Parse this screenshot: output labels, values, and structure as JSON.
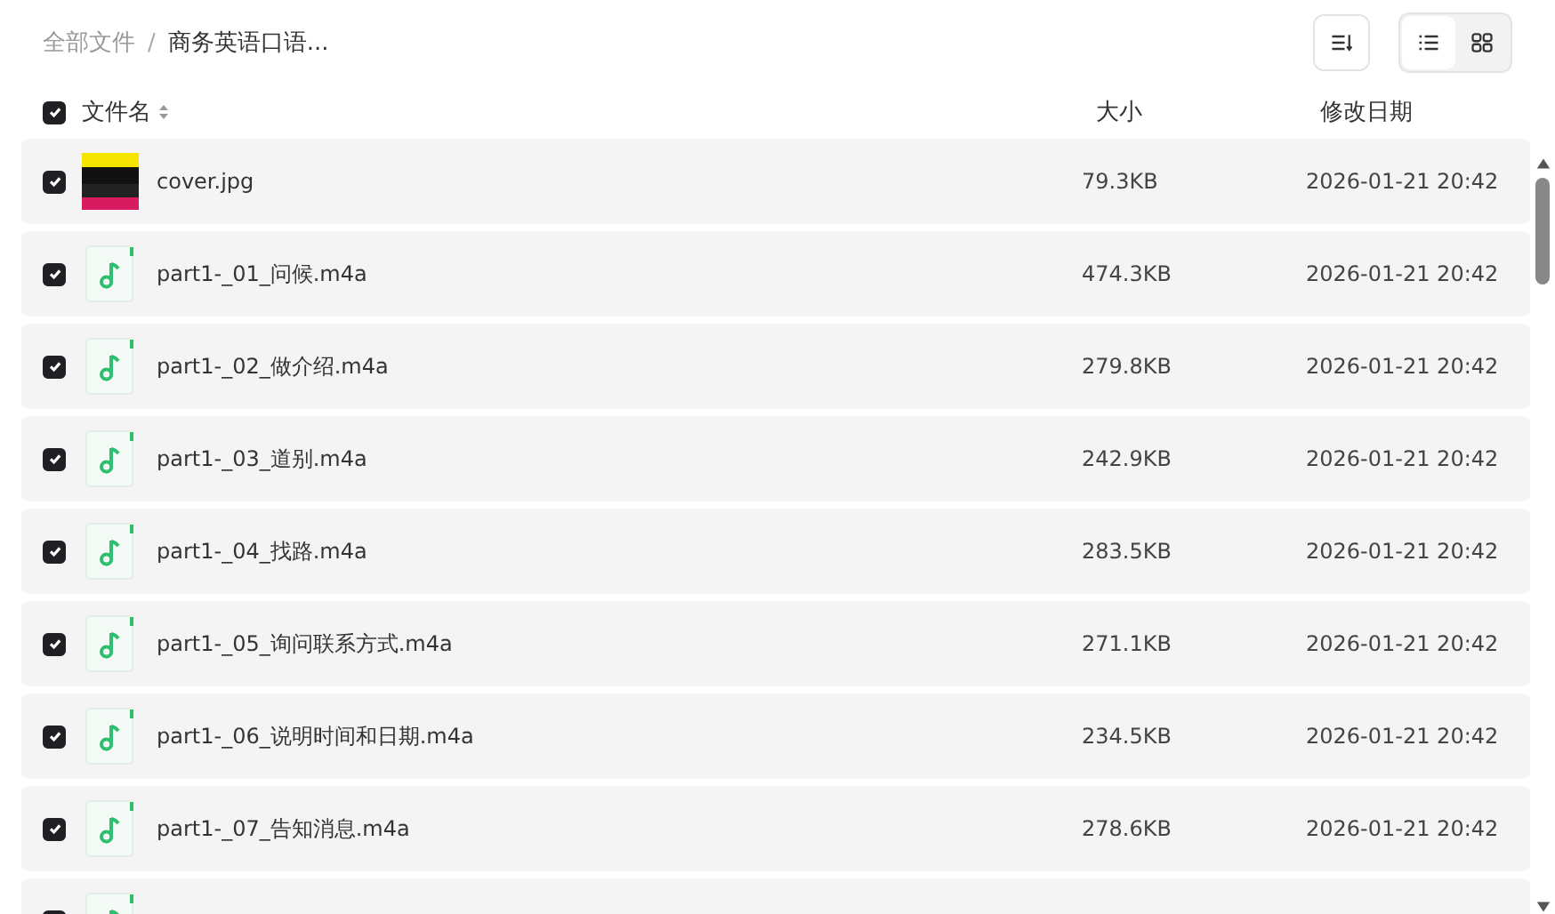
{
  "breadcrumb": [
    {
      "label": "全部文件",
      "current": false
    },
    {
      "label": "商务英语口语...",
      "current": true
    }
  ],
  "breadcrumb_separator": "/",
  "toolbar": {
    "views": [
      {
        "kind": "list",
        "selected": true
      },
      {
        "kind": "grid",
        "selected": false
      }
    ]
  },
  "table": {
    "select_all": {
      "checked": true
    },
    "columns": [
      "文件名",
      "大小",
      "修改日期"
    ],
    "rows": [
      {
        "kind": "image",
        "checked": true,
        "name": "cover.jpg",
        "size": "79.3KB",
        "modified": "2026-01-21 20:42"
      },
      {
        "kind": "audio",
        "checked": true,
        "name": "part1-_01_问候.m4a",
        "size": "474.3KB",
        "modified": "2026-01-21 20:42"
      },
      {
        "kind": "audio",
        "checked": true,
        "name": "part1-_02_做介绍.m4a",
        "size": "279.8KB",
        "modified": "2026-01-21 20:42"
      },
      {
        "kind": "audio",
        "checked": true,
        "name": "part1-_03_道别.m4a",
        "size": "242.9KB",
        "modified": "2026-01-21 20:42"
      },
      {
        "kind": "audio",
        "checked": true,
        "name": "part1-_04_找路.m4a",
        "size": "283.5KB",
        "modified": "2026-01-21 20:42"
      },
      {
        "kind": "audio",
        "checked": true,
        "name": "part1-_05_询问联系方式.m4a",
        "size": "271.1KB",
        "modified": "2026-01-21 20:42"
      },
      {
        "kind": "audio",
        "checked": true,
        "name": "part1-_06_说明时间和日期.m4a",
        "size": "234.5KB",
        "modified": "2026-01-21 20:42"
      },
      {
        "kind": "audio",
        "checked": true,
        "name": "part1-_07_告知消息.m4a",
        "size": "278.6KB",
        "modified": "2026-01-21 20:42"
      },
      {
        "kind": "audio",
        "checked": true
      }
    ]
  }
}
